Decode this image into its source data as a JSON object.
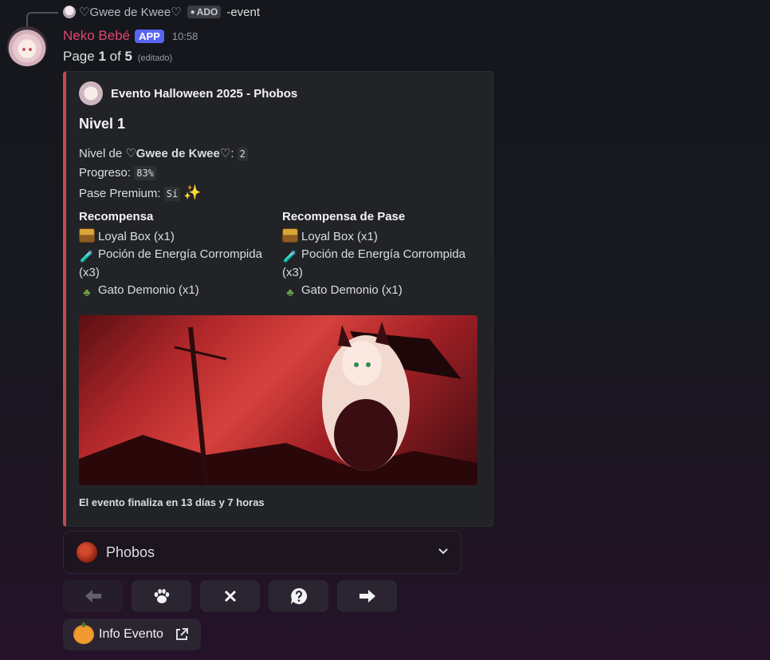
{
  "reply": {
    "user": "♡Gwee de Kwee♡",
    "badge": "ADO",
    "command": "-event"
  },
  "message": {
    "username": "Neko Bebé",
    "app_badge": "APP",
    "timestamp": "10:58",
    "page_prefix": "Page ",
    "page_current": "1",
    "page_of": " of ",
    "page_total": "5",
    "edited": "(editado)"
  },
  "embed": {
    "accent_color": "#c44a4f",
    "author": "Evento Halloween 2025 - Phobos",
    "title": "Nivel 1",
    "level_prefix": "Nivel de ",
    "level_user": "♡Gwee de Kwee♡",
    "level_colon": ":",
    "level_value": "2",
    "progress_label": "Progreso:",
    "progress_value": "83%",
    "premium_label": "Pase Premium:",
    "premium_value": "Sí",
    "premium_emoji": "✨",
    "fields": [
      {
        "name": "Recompensa",
        "items": [
          {
            "icon": "chest-icon",
            "text": "Loyal Box (x1)"
          },
          {
            "icon": "potion-icon",
            "text": "Poción de Energía Corrompida (x3)"
          },
          {
            "icon": "demon-cat-icon",
            "text": "Gato Demonio (x1)"
          }
        ]
      },
      {
        "name": "Recompensa de Pase",
        "items": [
          {
            "icon": "chest-icon",
            "text": "Loyal Box (x1)"
          },
          {
            "icon": "potion-icon",
            "text": "Poción de Energía Corrompida (x3)"
          },
          {
            "icon": "demon-cat-icon",
            "text": "Gato Demonio (x1)"
          }
        ]
      }
    ],
    "footer": "El evento finaliza en 13 días y 7 horas"
  },
  "select": {
    "icon": "moon-icon",
    "value": "Phobos"
  },
  "buttons": [
    {
      "icon": "arrow-left-icon",
      "disabled": true
    },
    {
      "icon": "paw-icon",
      "disabled": false
    },
    {
      "icon": "close-icon",
      "disabled": false
    },
    {
      "icon": "help-icon",
      "disabled": false
    },
    {
      "icon": "arrow-right-icon",
      "disabled": false
    }
  ],
  "link_button": {
    "icon": "pumpkin-icon",
    "label": "Info Evento",
    "trailing_icon": "external-link-icon"
  }
}
